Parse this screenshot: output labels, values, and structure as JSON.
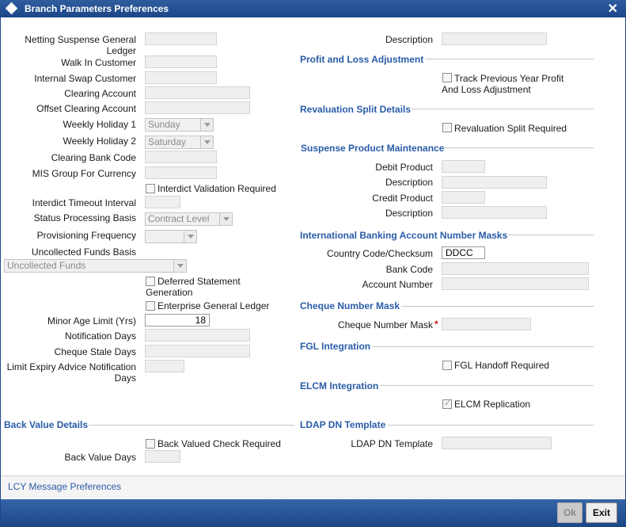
{
  "window": {
    "title": "Branch Parameters Preferences"
  },
  "left": {
    "netting_suspense_label": "Netting Suspense General Ledger",
    "walk_in_label": "Walk In Customer",
    "internal_swap_label": "Internal Swap Customer",
    "clearing_account_label": "Clearing Account",
    "offset_clearing_label": "Offset Clearing Account",
    "weekly_holiday1_label": "Weekly Holiday 1",
    "weekly_holiday1_value": "Sunday",
    "weekly_holiday2_label": "Weekly Holiday 2",
    "weekly_holiday2_value": "Saturday",
    "clearing_bank_code_label": "Clearing Bank Code",
    "mis_group_label": "MIS Group For Currency",
    "interdict_validation_label": "Interdict Validation Required",
    "interdict_timeout_label": "Interdict Timeout Interval",
    "status_processing_label": "Status Processing Basis",
    "status_processing_value": "Contract Level",
    "provisioning_label": "Provisioning Frequency",
    "provisioning_value": "",
    "uncollected_label": "Uncollected Funds Basis",
    "uncollected_value": "Uncollected Funds",
    "deferred_statement_label": "Deferred Statement Generation",
    "enterprise_gl_label": "Enterprise General Ledger",
    "minor_age_label": "Minor Age Limit (Yrs)",
    "minor_age_value": "18",
    "notification_days_label": "Notification Days",
    "cheque_stale_label": "Cheque Stale Days",
    "limit_expiry_label": "Limit Expiry Advice Notification Days"
  },
  "back_value": {
    "header": "Back Value Details",
    "check_label": "Back Valued Check Required",
    "days_label": "Back Value Days"
  },
  "right": {
    "description_label": "Description",
    "pnl_header": "Profit and Loss Adjustment",
    "track_label": "Track Previous Year Profit And Loss Adjustment",
    "reval_header": "Revaluation Split Details",
    "reval_label": "Revaluation Split Required",
    "suspense_header": "Suspense Product Maintenance",
    "debit_product_label": "Debit Product",
    "debit_desc_label": "Description",
    "credit_product_label": "Credit Product",
    "credit_desc_label": "Description",
    "iban_header": "International Banking Account Number Masks",
    "country_code_label": "Country Code/Checksum",
    "country_code_value": "DDCC",
    "bank_code_label": "Bank Code",
    "account_number_label": "Account Number",
    "cheque_header": "Cheque Number Mask",
    "cheque_mask_label": "Cheque Number Mask",
    "required_marker": "*",
    "fgl_header": "FGL Integration",
    "fgl_label": "FGL Handoff Required",
    "elcm_header": "ELCM Integration",
    "elcm_label": "ELCM Replication",
    "ldap_header": "LDAP DN Template",
    "ldap_label": "LDAP DN Template"
  },
  "footer": {
    "lcy_link": "LCY Message Preferences",
    "ok_label": "Ok",
    "exit_label": "Exit"
  },
  "colors": {
    "titlebar": "#1d4787",
    "section_header": "#2a5ca8",
    "required": "#d01010"
  },
  "icons": {
    "close": "close-icon",
    "window": "diamond-icon"
  }
}
